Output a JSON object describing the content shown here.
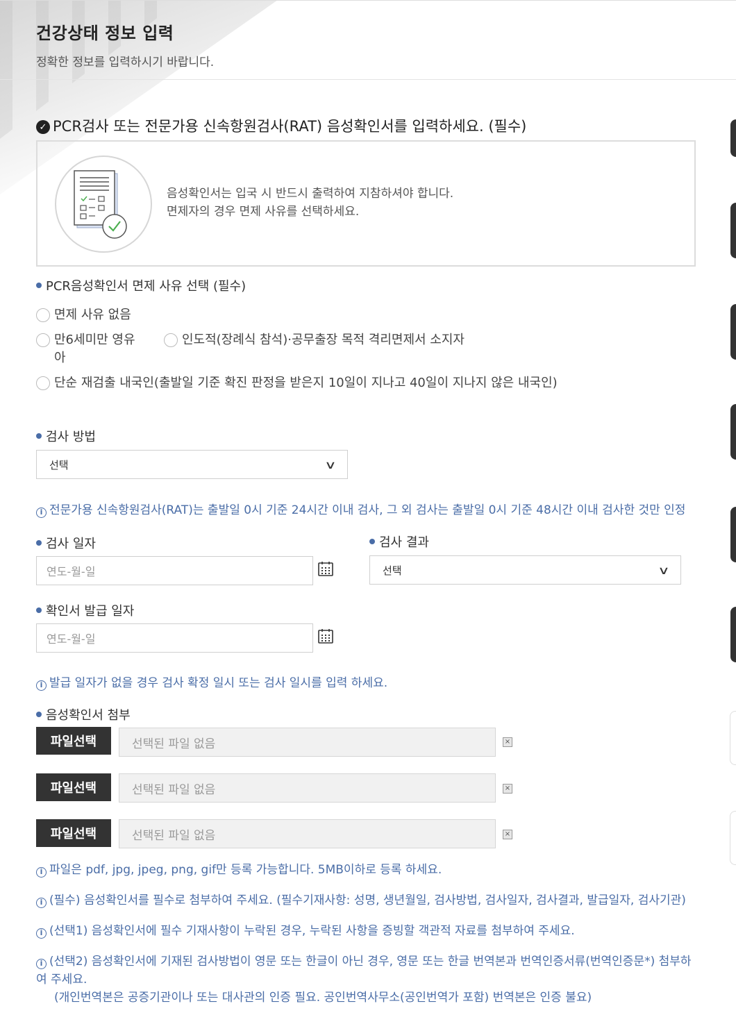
{
  "header": {
    "title": "건강상태 정보 입력",
    "subtitle": "정확한 정보를 입력하시기 바랍니다."
  },
  "pcr_section": {
    "title": "PCR검사 또는 전문가용 신속항원검사(RAT) 음성확인서를 입력하세요. (필수)",
    "info_line1": "음성확인서는 입국 시 반드시 출력하여 지참하셔야 합니다.",
    "info_line2": "면제자의 경우 면제 사유를 선택하세요."
  },
  "exemption": {
    "label": "PCR음성확인서 면제 사유 선택 (필수)",
    "options": [
      "면제 사유 없음",
      "만6세미만 영유아",
      "인도적(장례식 참석)·공무출장 목적 격리면제서 소지자",
      "단순 재검출 내국인(출발일 기준 확진 판정을 받은지 10일이 지나고 40일이 지나지 않은 내국인)"
    ]
  },
  "test_method": {
    "label": "검사 방법",
    "selected": "선택"
  },
  "rat_note": "전문가용 신속항원검사(RAT)는 출발일 0시 기준 24시간 이내 검사, 그 외 검사는 출발일 0시 기준 48시간 이내 검사한 것만 인정",
  "test_date": {
    "label": "검사 일자",
    "placeholder": "연도-월-일"
  },
  "test_result": {
    "label": "검사 결과",
    "selected": "선택"
  },
  "issue_date": {
    "label": "확인서 발급 일자",
    "placeholder": "연도-월-일"
  },
  "issue_note": "발급 일자가 없을 경우 검사 확정 일시 또는 검사 일시를 입력 하세요.",
  "attach": {
    "label": "음성확인서 첨부",
    "button_label": "파일선택",
    "empty_text": "선택된 파일 없음",
    "remove_glyph": "×"
  },
  "notes": [
    "파일은 pdf, jpg, jpeg, png, gif만 등록 가능합니다. 5MB이하로 등록 하세요.",
    "(필수) 음성확인서를 필수로 첨부하여 주세요. (필수기재사항: 성명, 생년월일, 검사방법, 검사일자, 검사결과, 발급일자, 검사기관)",
    "(선택1) 음성확인서에 필수 기재사항이 누락된 경우, 누락된 사항을 증빙할 객관적 자료를 첨부하여 주세요.",
    "(선택2) 음성확인서에 기재된 검사방법이 영문 또는 한글이 아닌 경우, 영문 또는 한글 번역본과 번역인증서류(번역인증문*) 첨부하여 주세요.",
    "(개인번역본은 공증기관이나 또는 대사관의 인증 필요. 공인번역사무소(공인번역가 포함) 번역본은 인증 불요)"
  ],
  "icons": {
    "check": "check-circle-icon",
    "info": "info-circle-icon",
    "calendar": "calendar-icon",
    "chevron": "chevron-down-icon",
    "document": "document-check-icon"
  },
  "colors": {
    "accent": "#4a6da7",
    "button": "#333333"
  }
}
